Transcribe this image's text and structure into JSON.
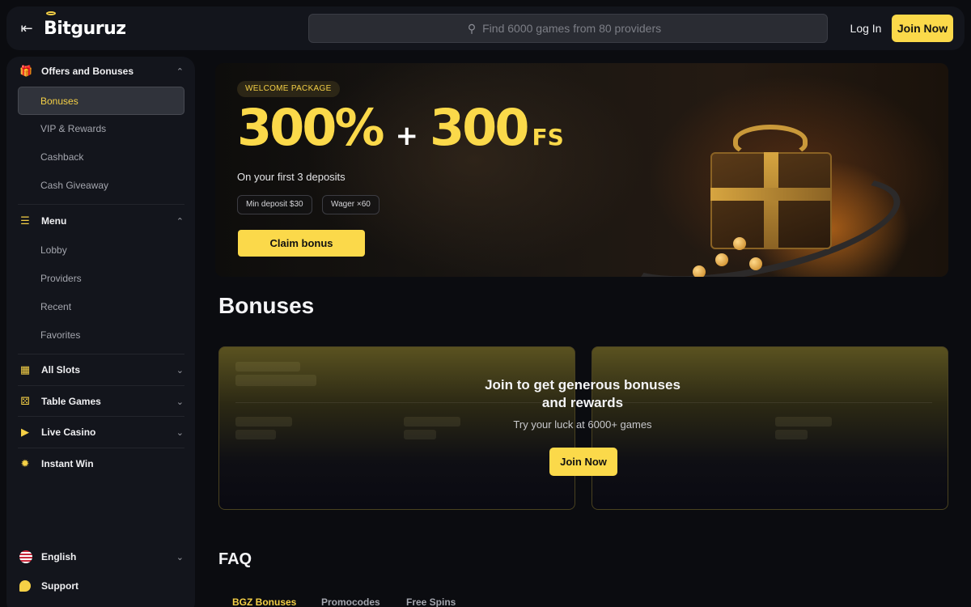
{
  "header": {
    "collapse_icon": "collapse-left-icon",
    "logo_text": "Bitguruz",
    "search_placeholder": "Find 6000 games from 80 providers",
    "login_label": "Log In",
    "join_label": "Join Now"
  },
  "sidebar": {
    "offers": {
      "title": "Offers and Bonuses",
      "icon": "gift-icon",
      "items": [
        {
          "label": "Bonuses",
          "active": true
        },
        {
          "label": "VIP & Rewards"
        },
        {
          "label": "Cashback"
        },
        {
          "label": "Cash Giveaway"
        }
      ]
    },
    "menu": {
      "title": "Menu",
      "icon": "menu-search-icon",
      "items": [
        {
          "label": "Lobby"
        },
        {
          "label": "Providers"
        },
        {
          "label": "Recent"
        },
        {
          "label": "Favorites"
        }
      ]
    },
    "categories": [
      {
        "label": "All Slots",
        "icon": "slots-grid-icon"
      },
      {
        "label": "Table Games",
        "icon": "dice-icon"
      },
      {
        "label": "Live Casino",
        "icon": "play-icon"
      },
      {
        "label": "Instant Win",
        "icon": "burst-icon"
      }
    ],
    "language": "English",
    "support": "Support"
  },
  "hero": {
    "badge": "WELCOME PACKAGE",
    "percent": "300%",
    "plus": "+",
    "spins": "300",
    "fs": "FS",
    "subtitle": "On your first 3 deposits",
    "chips": [
      "Min deposit $30",
      "Wager ×60"
    ],
    "claim_label": "Claim bonus"
  },
  "bonuses": {
    "title": "Bonuses",
    "overlay_title_line1": "Join to get generous bonuses",
    "overlay_title_line2": "and rewards",
    "overlay_sub": "Try your luck at 6000+ games",
    "join_label": "Join Now"
  },
  "faq": {
    "title": "FAQ",
    "tabs": [
      "BGZ Bonuses",
      "Promocodes",
      "Free Spins"
    ]
  },
  "colors": {
    "accent": "#fbd94a",
    "background": "#0b0c10",
    "panel": "#13151c"
  }
}
